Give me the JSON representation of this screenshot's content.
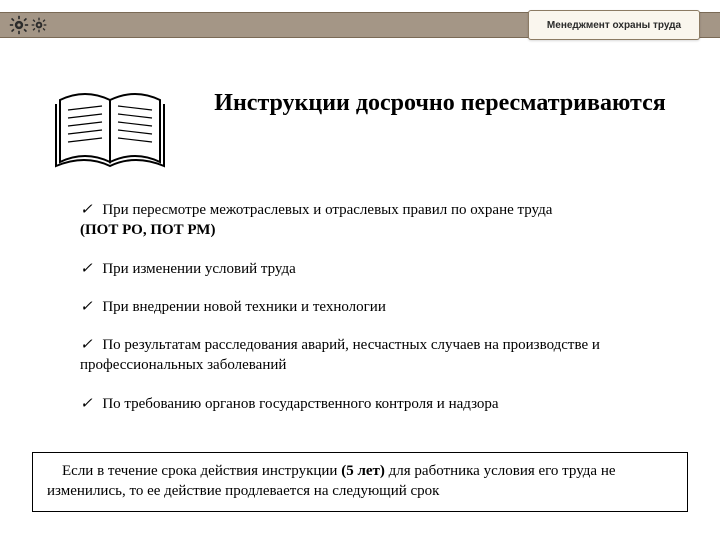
{
  "header": {
    "tab_label": "Менеджмент охраны труда"
  },
  "title": "Инструкции  досрочно пересматриваются",
  "items": [
    {
      "text": "При пересмотре межотраслевых и отраслевых правил  по охране труда",
      "suffix_bold": "(ПОТ РО, ПОТ РМ)"
    },
    {
      "text": "При изменении условий труда",
      "suffix_bold": ""
    },
    {
      "text": "При внедрении новой техники и технологии",
      "suffix_bold": ""
    },
    {
      "text": "По результатам расследования аварий, несчастных случаев на производстве и профессиональных заболеваний",
      "suffix_bold": ""
    },
    {
      "text": "По  требованию  органов  государственного контроля и надзора",
      "suffix_bold": ""
    }
  ],
  "footer": {
    "pre": "Если в течение срока действия инструкции ",
    "bold": "(5 лет)",
    "post": "  для  работника  условия  его труда не изменились,  то ее действие продлевается на следующий срок"
  },
  "icons": {
    "gear": "gear-icon",
    "book": "book-icon",
    "check": "✓"
  }
}
